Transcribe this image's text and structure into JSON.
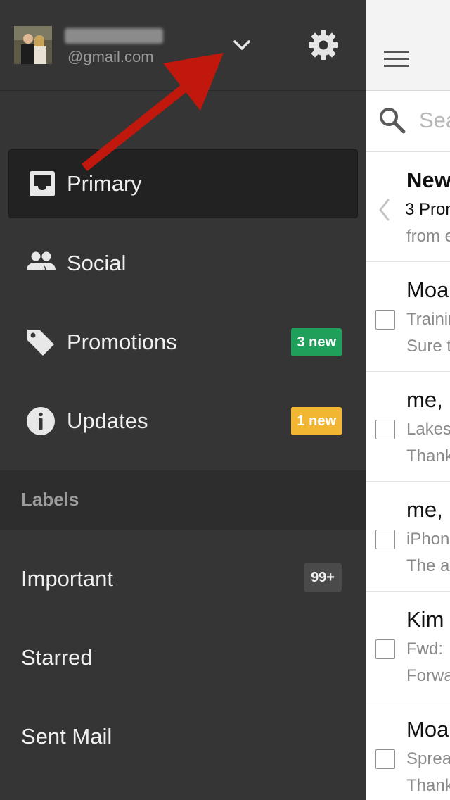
{
  "account": {
    "email": "@gmail.com"
  },
  "drawer": {
    "categories": [
      {
        "label": "Primary",
        "badge": ""
      },
      {
        "label": "Social",
        "badge": ""
      },
      {
        "label": "Promotions",
        "badge": "3 new",
        "badge_color": "#1e9f5a"
      },
      {
        "label": "Updates",
        "badge": "1 new",
        "badge_color": "#f2b632"
      }
    ],
    "labels_header": "Labels",
    "labels": [
      {
        "label": "Important",
        "count": "99+"
      },
      {
        "label": "Starred"
      },
      {
        "label": "Sent Mail"
      }
    ]
  },
  "main": {
    "search_placeholder": "Sea",
    "promo": {
      "title": "New",
      "subtitle": "3 Pron",
      "from": "from e"
    },
    "emails": [
      {
        "sender": "Moa",
        "subject": "Trainin",
        "snippet": "Sure t"
      },
      {
        "sender": "me,",
        "subject": "Lakes",
        "snippet": "Thank"
      },
      {
        "sender": "me,",
        "subject": "iPhon",
        "snippet": "The a"
      },
      {
        "sender": "Kim",
        "subject": "Fwd:",
        "snippet": "Forwa"
      },
      {
        "sender": "Moa",
        "subject": "Sprea",
        "snippet": "Thank"
      }
    ]
  },
  "colors": {
    "drawer_bg": "#353535",
    "annotation_arrow": "#c0180c"
  }
}
